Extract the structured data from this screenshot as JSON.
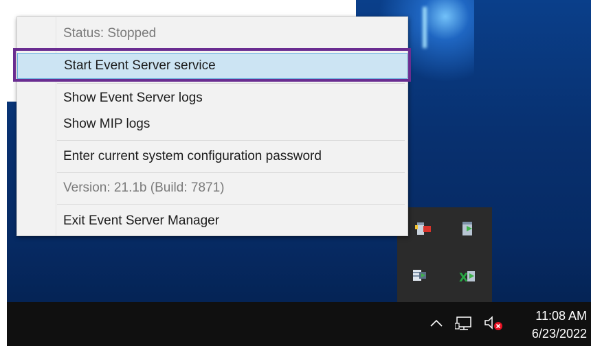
{
  "context_menu": {
    "items": [
      {
        "label": "Status: Stopped",
        "enabled": false
      },
      {
        "label": "Start Event Server service",
        "enabled": true,
        "highlighted": true
      },
      {
        "label": "Show Event Server logs",
        "enabled": true
      },
      {
        "label": "Show MIP logs",
        "enabled": true
      },
      {
        "label": "Enter current system configuration password",
        "enabled": true
      },
      {
        "label": "Version: 21.1b (Build: 7871)",
        "enabled": false
      },
      {
        "label": "Exit Event Server Manager",
        "enabled": true
      }
    ]
  },
  "tray_overflow": {
    "icons": [
      "event-server-stopped-icon",
      "management-server-icon",
      "recording-server-icon",
      "xprotect-icon"
    ]
  },
  "taskbar": {
    "time": "11:08 AM",
    "date": "6/23/2022",
    "icons": [
      "chevron-up-icon",
      "network-icon",
      "speaker-muted-icon"
    ]
  },
  "colors": {
    "highlight_fill": "#cce4f3",
    "highlight_border": "#6ab0de",
    "focus_outline": "#6a2d91",
    "mute_badge": "#e81123"
  }
}
